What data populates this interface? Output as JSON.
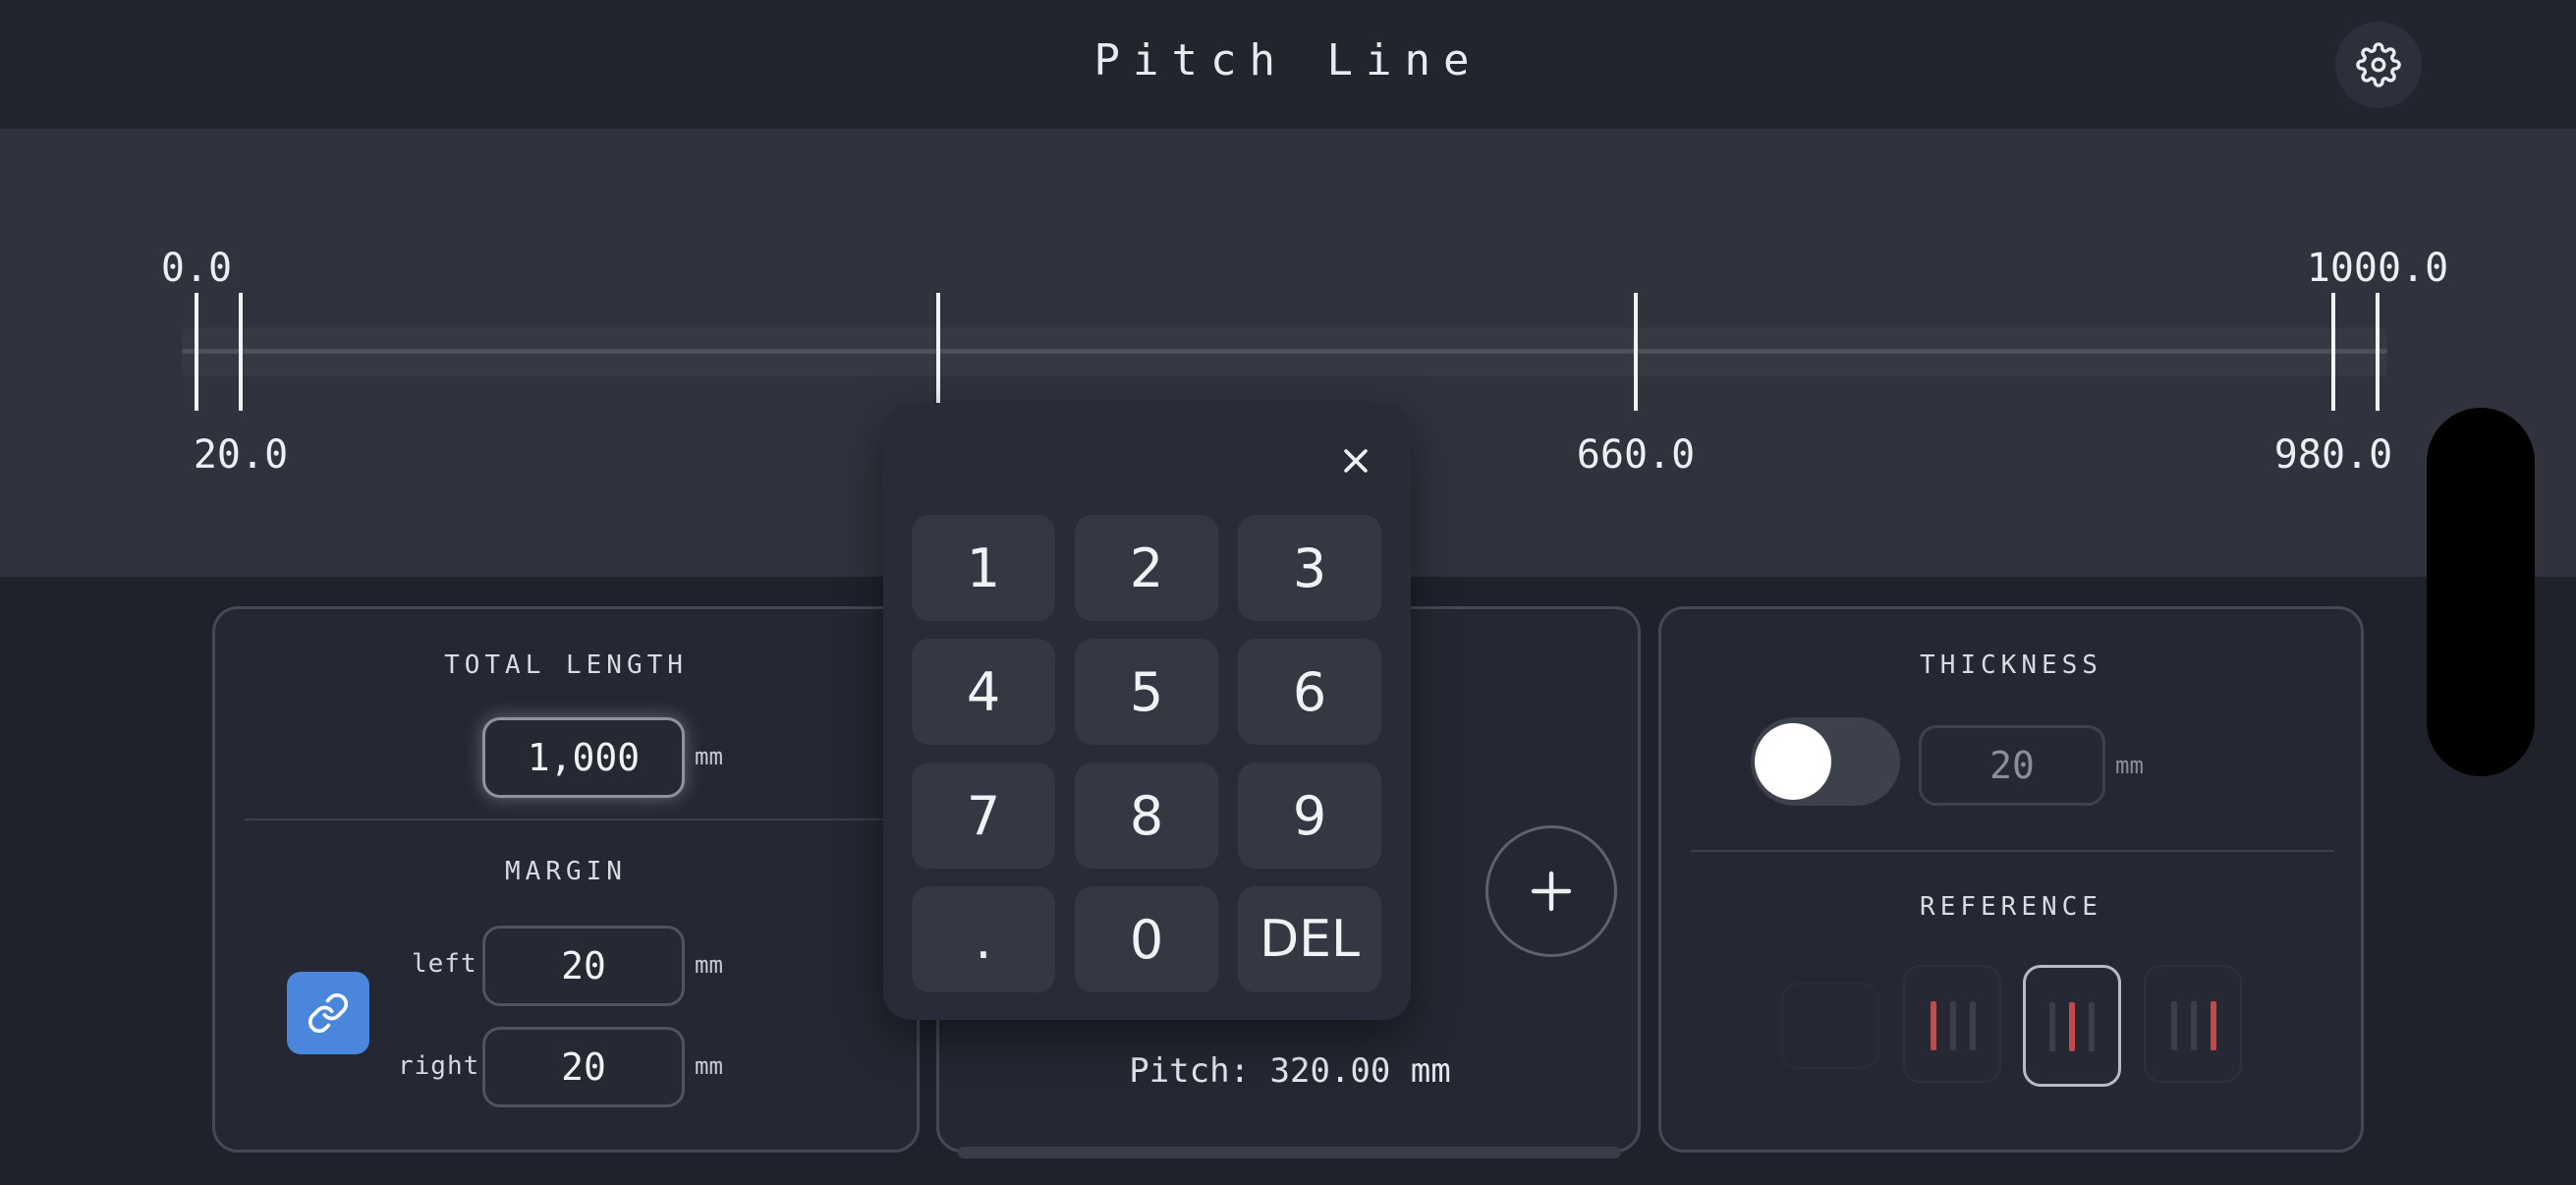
{
  "header": {
    "title": "Pitch Line"
  },
  "ruler": {
    "start_label": "0.0",
    "end_label": "1000.0",
    "tick_labels": [
      "20.0",
      "660.0",
      "980.0"
    ]
  },
  "keypad": {
    "keys": [
      "1",
      "2",
      "3",
      "4",
      "5",
      "6",
      "7",
      "8",
      "9",
      ".",
      "0",
      "DEL"
    ]
  },
  "length_panel": {
    "total_length_title": "TOTAL LENGTH",
    "total_length_value": "1,000",
    "unit": "mm",
    "margin_title": "MARGIN",
    "left_label": "left",
    "left_value": "20",
    "right_label": "right",
    "right_value": "20"
  },
  "pitch": {
    "text": "Pitch: 320.00 mm"
  },
  "style_panel": {
    "thickness_title": "THICKNESS",
    "thickness_value": "20",
    "thickness_unit": "mm",
    "thickness_toggle_on": false,
    "reference_title": "REFERENCE",
    "reference_selected_index": 2
  },
  "colors": {
    "accent_blue": "#4a86dc",
    "reference_red": "#c24a48",
    "background": "#1f222b"
  },
  "icons": {
    "settings": "gear-icon",
    "close": "close-icon",
    "add": "plus-icon",
    "link": "link-icon"
  }
}
